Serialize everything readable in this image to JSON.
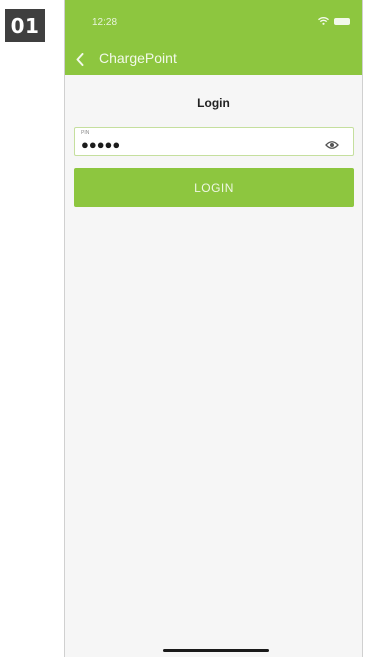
{
  "step_badge": "01",
  "status_bar": {
    "time": "12:28"
  },
  "header": {
    "title": "ChargePoint",
    "back_icon": "chevron-left-icon"
  },
  "page": {
    "title": "Login"
  },
  "pin_field": {
    "label": "PIN",
    "value": "●●●●●",
    "visibility_icon": "eye-icon"
  },
  "login_button": {
    "label": "LOGIN"
  },
  "colors": {
    "accent": "#8dc63f",
    "badge": "#3f3f3f",
    "background": "#f6f6f6"
  }
}
